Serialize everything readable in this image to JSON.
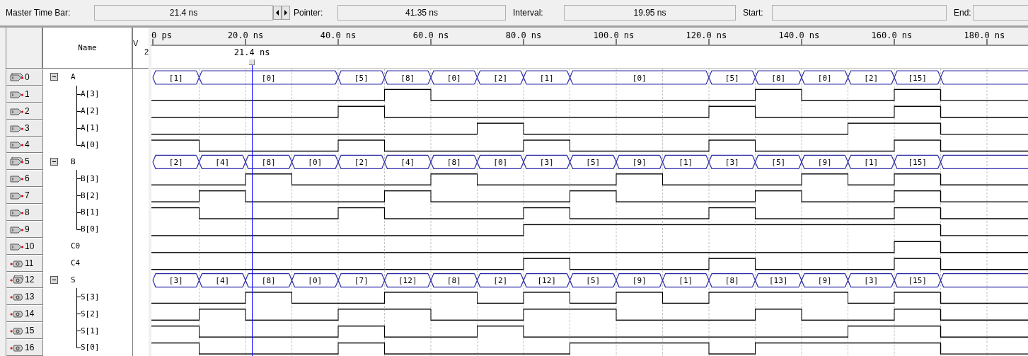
{
  "toolbar": {
    "fields": [
      {
        "label": "Master Time Bar:",
        "value": "21.4 ns",
        "stepper": true
      },
      {
        "label": "Pointer:",
        "value": "41.35 ns"
      },
      {
        "label": "Interval:",
        "value": "19.95 ns"
      },
      {
        "label": "Start:"
      },
      {
        "label": "End:"
      }
    ]
  },
  "header": {
    "name": "Name",
    "value_title": "V",
    "value_subtitle": "2"
  },
  "ruler": {
    "ticks": [
      "0 ps",
      "20.0 ns",
      "40.0 ns",
      "60.0 ns",
      "80.0 ns",
      "100.0 ns",
      "120.0 ns",
      "140.0 ns",
      "160.0 ns",
      "180.0 ns"
    ]
  },
  "master_marker": "21.4 ns",
  "signals": [
    {
      "index": "0",
      "name": "A",
      "kind": "input",
      "expanded": true,
      "bus": [
        {
          "value": "[1]",
          "continued": false
        },
        {
          "value": "[0]",
          "continued": false
        },
        {
          "continued": true
        },
        {
          "continued": true
        },
        {
          "value": "[5]",
          "continued": false
        },
        {
          "value": "[8]",
          "continued": false
        },
        {
          "value": "[0]",
          "continued": false
        },
        {
          "value": "[2]",
          "continued": false
        },
        {
          "value": "[1]",
          "continued": false
        },
        {
          "value": "[0]",
          "continued": false
        },
        {
          "continued": true
        },
        {
          "continued": true
        },
        {
          "value": "[5]",
          "continued": false
        },
        {
          "value": "[8]",
          "continued": false
        },
        {
          "value": "[0]",
          "continued": false
        },
        {
          "value": "[2]",
          "continued": false
        },
        {
          "value": "[15]",
          "continued": false
        }
      ],
      "children": [
        {
          "index": "1",
          "name": "A[3]",
          "kind": "input",
          "high": [
            false,
            false,
            false,
            false,
            false,
            true,
            false,
            false,
            false,
            false,
            false,
            false,
            false,
            true,
            false,
            false,
            true
          ]
        },
        {
          "index": "2",
          "name": "A[2]",
          "kind": "input",
          "high": [
            false,
            false,
            false,
            false,
            true,
            false,
            false,
            false,
            false,
            false,
            false,
            false,
            true,
            false,
            false,
            false,
            true
          ]
        },
        {
          "index": "3",
          "name": "A[1]",
          "kind": "input",
          "high": [
            false,
            false,
            false,
            false,
            false,
            false,
            false,
            true,
            false,
            false,
            false,
            false,
            false,
            false,
            false,
            true,
            true
          ]
        },
        {
          "index": "4",
          "name": "A[0]",
          "kind": "input",
          "high": [
            true,
            false,
            false,
            false,
            true,
            false,
            false,
            false,
            true,
            false,
            false,
            false,
            true,
            false,
            false,
            false,
            true
          ]
        }
      ]
    },
    {
      "index": "5",
      "name": "B",
      "kind": "input",
      "expanded": true,
      "bus": [
        {
          "value": "[2]",
          "continued": false
        },
        {
          "value": "[4]",
          "continued": false
        },
        {
          "value": "[8]",
          "continued": false
        },
        {
          "value": "[0]",
          "continued": false
        },
        {
          "value": "[2]",
          "continued": false
        },
        {
          "value": "[4]",
          "continued": false
        },
        {
          "value": "[8]",
          "continued": false
        },
        {
          "value": "[0]",
          "continued": false
        },
        {
          "value": "[3]",
          "continued": false
        },
        {
          "value": "[5]",
          "continued": false
        },
        {
          "value": "[9]",
          "continued": false
        },
        {
          "value": "[1]",
          "continued": false
        },
        {
          "value": "[3]",
          "continued": false
        },
        {
          "value": "[5]",
          "continued": false
        },
        {
          "value": "[9]",
          "continued": false
        },
        {
          "value": "[1]",
          "continued": false
        },
        {
          "value": "[15]",
          "continued": false
        }
      ],
      "children": [
        {
          "index": "6",
          "name": "B[3]",
          "kind": "input",
          "high": [
            false,
            false,
            true,
            false,
            false,
            false,
            true,
            false,
            false,
            false,
            true,
            false,
            false,
            false,
            true,
            false,
            true
          ]
        },
        {
          "index": "7",
          "name": "B[2]",
          "kind": "input",
          "high": [
            false,
            true,
            false,
            false,
            false,
            true,
            false,
            false,
            false,
            true,
            false,
            false,
            false,
            true,
            false,
            false,
            true
          ]
        },
        {
          "index": "8",
          "name": "B[1]",
          "kind": "input",
          "high": [
            true,
            false,
            false,
            false,
            true,
            false,
            false,
            false,
            true,
            false,
            false,
            false,
            true,
            false,
            false,
            false,
            true
          ]
        },
        {
          "index": "9",
          "name": "B[0]",
          "kind": "input",
          "high": [
            false,
            false,
            false,
            false,
            false,
            false,
            false,
            false,
            true,
            true,
            true,
            true,
            true,
            true,
            true,
            true,
            true
          ]
        }
      ]
    },
    {
      "index": "10",
      "name": "C0",
      "kind": "input",
      "high": [
        false,
        false,
        false,
        false,
        false,
        false,
        false,
        false,
        false,
        false,
        false,
        false,
        false,
        false,
        false,
        false,
        true
      ]
    },
    {
      "index": "11",
      "name": "C4",
      "kind": "output",
      "high": [
        false,
        false,
        false,
        false,
        false,
        false,
        false,
        false,
        true,
        false,
        false,
        false,
        true,
        false,
        false,
        false,
        true
      ]
    },
    {
      "index": "12",
      "name": "S",
      "kind": "output",
      "expanded": true,
      "bus": [
        {
          "value": "[3]",
          "continued": false
        },
        {
          "value": "[4]",
          "continued": false
        },
        {
          "value": "[8]",
          "continued": false
        },
        {
          "value": "[0]",
          "continued": false
        },
        {
          "value": "[7]",
          "continued": false
        },
        {
          "value": "[12]",
          "continued": false
        },
        {
          "value": "[8]",
          "continued": false
        },
        {
          "value": "[2]",
          "continued": false
        },
        {
          "value": "[12]",
          "continued": false
        },
        {
          "value": "[5]",
          "continued": false
        },
        {
          "value": "[9]",
          "continued": false
        },
        {
          "value": "[1]",
          "continued": false
        },
        {
          "value": "[8]",
          "continued": false
        },
        {
          "value": "[13]",
          "continued": false
        },
        {
          "value": "[9]",
          "continued": false
        },
        {
          "value": "[3]",
          "continued": false
        },
        {
          "value": "[15]",
          "continued": false
        }
      ],
      "children": [
        {
          "index": "13",
          "name": "S[3]",
          "kind": "output",
          "high": [
            false,
            false,
            true,
            false,
            false,
            true,
            true,
            false,
            true,
            false,
            true,
            false,
            true,
            true,
            true,
            false,
            true
          ]
        },
        {
          "index": "14",
          "name": "S[2]",
          "kind": "output",
          "high": [
            false,
            true,
            false,
            false,
            true,
            true,
            false,
            false,
            true,
            true,
            false,
            false,
            false,
            true,
            false,
            false,
            true
          ]
        },
        {
          "index": "15",
          "name": "S[1]",
          "kind": "output",
          "high": [
            true,
            false,
            false,
            false,
            true,
            false,
            false,
            true,
            false,
            false,
            false,
            false,
            false,
            false,
            false,
            true,
            true
          ]
        },
        {
          "index": "16",
          "name": "S[0]",
          "kind": "output",
          "high": [
            true,
            false,
            false,
            false,
            true,
            false,
            false,
            false,
            false,
            true,
            true,
            true,
            false,
            true,
            true,
            true,
            true
          ]
        }
      ]
    }
  ]
}
